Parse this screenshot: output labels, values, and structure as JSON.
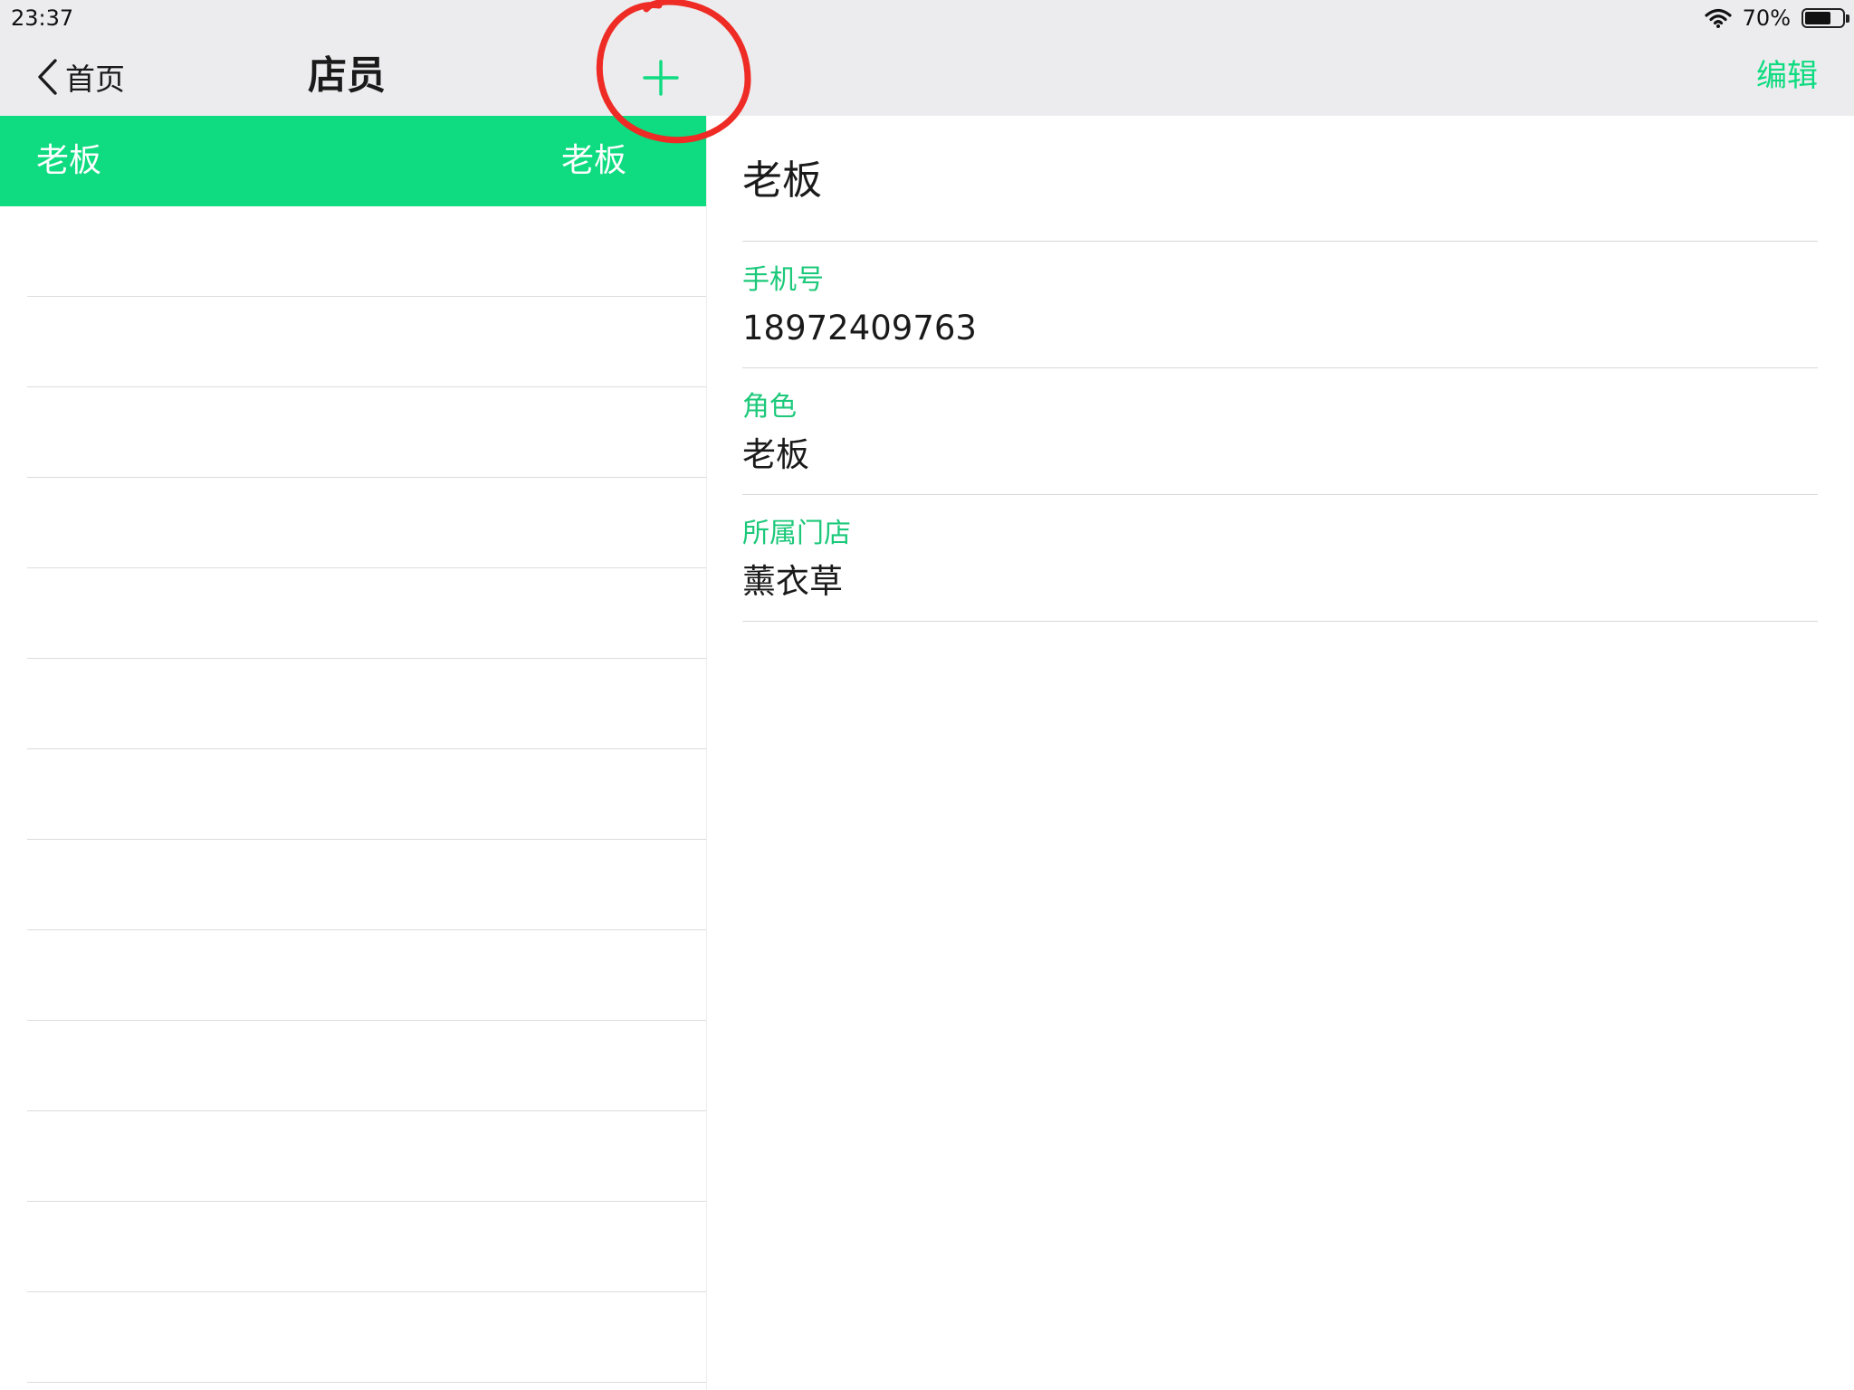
{
  "status_bar": {
    "time": "23:37",
    "battery_percent": "70%",
    "battery_level": 0.7
  },
  "nav": {
    "back_label": "首页",
    "title": "店员",
    "edit_label": "编辑"
  },
  "staff_list": [
    {
      "name": "老板",
      "role": "老板",
      "selected": true
    }
  ],
  "detail": {
    "name": "老板",
    "fields": [
      {
        "label": "手机号",
        "value": "18972409763"
      },
      {
        "label": "角色",
        "value": "老板"
      },
      {
        "label": "所属门店",
        "value": "薰衣草"
      }
    ]
  },
  "colors": {
    "accent": "#0fdb80",
    "label": "#1cc97a",
    "annotation": "#ee2b24",
    "nav_bg": "#ececee"
  },
  "icons": {
    "back": "chevron-left-icon",
    "add": "plus-icon",
    "wifi": "wifi-icon",
    "battery": "battery-icon"
  }
}
